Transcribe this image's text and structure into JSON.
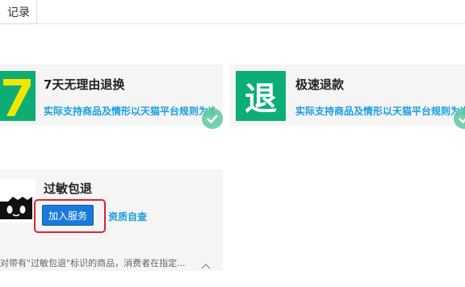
{
  "tabbar": {
    "active_tab": "记录"
  },
  "cards": [
    {
      "title": "7天无理由退换",
      "desc": "实际支持商品及情形以天猫平台规则为准",
      "badge_text": "7"
    },
    {
      "title": "极速退款",
      "desc": "实际支持商品及情形以天猫平台规则为准",
      "badge_text": "退"
    }
  ],
  "allergy_card": {
    "title": "过敏包退",
    "join_label": "加入服务",
    "link_label": "资质自查",
    "note": "对带有\"过敏包退\"标识的商品，消费者在指定..."
  },
  "colors": {
    "accent_green": "#0cae76",
    "link_blue": "#1a9fe0",
    "button_blue": "#1a7ad9",
    "highlight_red": "#e0242b"
  },
  "icons": [
    "check-circle-icon",
    "tmall-cat-icon",
    "chevron-up-icon"
  ]
}
